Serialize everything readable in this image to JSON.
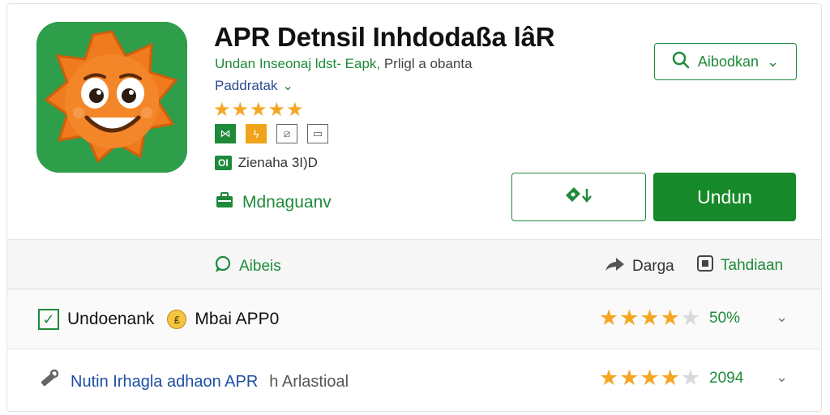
{
  "app": {
    "title": "APR Detnsil Inhdodaßa lâR",
    "subtitle_green": "Undan Inseonaj ldst- Eapk,",
    "subtitle_gray": " Prligl a obanta",
    "developer": "Paddratak",
    "rating_stars": "★★★★★",
    "age_badge": "OI",
    "age_text": "Zienaha 3I)D",
    "category": "Mdnaguanv",
    "icon": "sun-mascot-icon"
  },
  "buttons": {
    "search_label": "Aibodkan",
    "wishlist_icon": "tag-icon",
    "install_label": "Undun"
  },
  "action_bar": {
    "reviews_label": "Aibeis",
    "share_label": "Darga",
    "add_label": "Tahdiaan"
  },
  "rows": [
    {
      "label": "Undoenank",
      "coin_label": "Mbai APP0",
      "stars_on": "★★★★",
      "stars_off": "★",
      "percent": "50%"
    },
    {
      "label_blue": "Nutin Irhagla adhaon APR",
      "label_gray": "h Arlastioal",
      "stars_on": "★★★★",
      "stars_off": "★",
      "percent": "2094"
    }
  ],
  "colors": {
    "accent": "#1f8a3a",
    "install": "#168a2b",
    "star": "#f5a623",
    "link_blue": "#1e4fa3"
  }
}
